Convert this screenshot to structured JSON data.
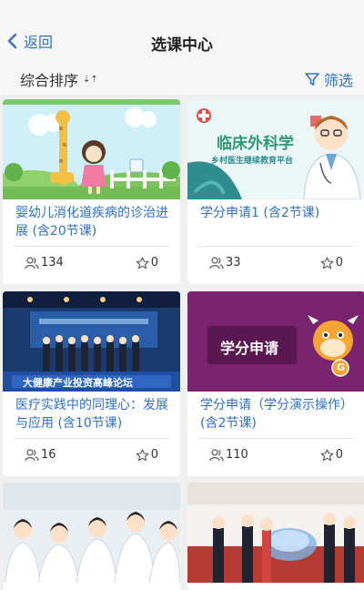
{
  "nav": {
    "back_label": "返回",
    "title": "选课中心"
  },
  "toolbar": {
    "sort_label": "综合排序",
    "sort_icon": "⇣⇡",
    "filter_label": "筛选"
  },
  "cards": [
    {
      "title": "婴幼儿消化道疾病的诊治进展 (含20节课)",
      "students": "134",
      "favorites": "0"
    },
    {
      "title": "学分申请1 (含2节课)",
      "students": "33",
      "favorites": "0",
      "thumb_heading": "临床外科学",
      "thumb_subheading": "乡村医生继续教育平台"
    },
    {
      "title": "医疗实践中的同理心：发展与应用 (含10节课)",
      "students": "16",
      "favorites": "0",
      "thumb_banner": "大健康产业投资高峰论坛"
    },
    {
      "title": "学分申请（学分演示操作） (含2节课)",
      "students": "110",
      "favorites": "0",
      "thumb_heading": "学分申请",
      "thumb_badge": "G"
    },
    {
      "title": ""
    },
    {
      "title": ""
    }
  ]
}
